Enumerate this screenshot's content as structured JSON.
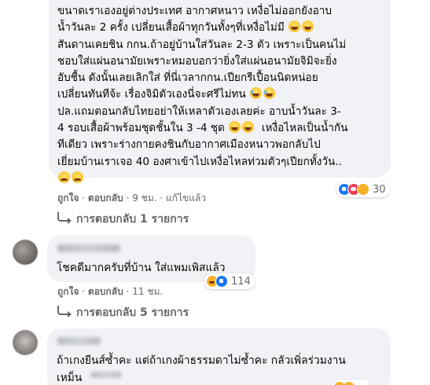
{
  "comment1": {
    "text_lines": [
      "ขนาดเราเองอยู่ต่างประเทศ อากาศหนาว เหงื่อไม่ออกยังอาบ",
      "น้ำวันละ 2 ครั้ง เปลี่ยนเสื้อผ้าทุกวันทั้งๆที่เหงื่อไม่มี",
      "สันดานเคยชิน กกน.ถ้าอยู่บ้านใส่วันละ 2-3 ตัว เพราะเป็นคนไม่",
      "ชอบใส่แผ่นอนามัยเพราะหมอบอกว่ายิ่งใส่แผ่นอนามัยจิมิจะยิ่ง",
      "อับชื้น ดังนั้นเลยเลิกใส่ ที่นี่เวลากกน.เปียกรีเปื้อนนิดหน่อย",
      "เปลี่ยนทันทีจ้ะ เรื่องจิมิตัวเองนี่จะศรีไม่ทน",
      "ปล.แถมตอนกลับไทยอย่าให้เหลาตัวเองเลยค่ะ อาบน้ำวันละ 3-",
      "4 รอบเสื้อผ้าพร้อมชุดชั้นใน 3 -4 ชุด",
      "เหงื่อไหลเป็นน้ำกัน",
      "ทีเดียว เพราะร่างกายคงชินกับอากาศเมืองหนาวพอกลับไป",
      "เยี่ยมบ้านเราเจอ 40 องศาเข้าไปเหงื่อไหลท่วมตัวๆเปียกทั้งวัน.."
    ],
    "like_label": "ถูกใจ",
    "reply_label": "ตอบกลับ",
    "time": "9 ชม.",
    "edited_label": "แก้ไขแล้ว",
    "reaction_icons": [
      "like-icon",
      "love-icon",
      "care-icon"
    ],
    "reaction_count": "30",
    "replies_label": "การตอบกลับ 1 รายการ"
  },
  "comment2": {
    "text": "โชคดีมากครับที่บ้าน ใส่แพมเพิสแล้ว",
    "like_label": "ถูกใจ",
    "reply_label": "ตอบกลับ",
    "time": "11 ชม.",
    "reaction_icons": [
      "haha-icon",
      "like-icon"
    ],
    "reaction_count": "114",
    "replies_label": "การตอบกลับ 5 รายการ"
  },
  "comment3": {
    "text_lines": [
      "ถ้าเกงยีนส์ซ้ำคะ แต่ถ้าเกงผ้าธรรมดาไม่ซ้ำคะ กลัวเพิ่ลร่วมงาน",
      "เหม็น"
    ]
  },
  "colors": {
    "bubble": "#f0f2f5",
    "meta_text": "#65676b",
    "like_blue": "#1877f2",
    "love_red": "#f33e58",
    "emoji_yellow": "#f7b125"
  },
  "separator": "·"
}
